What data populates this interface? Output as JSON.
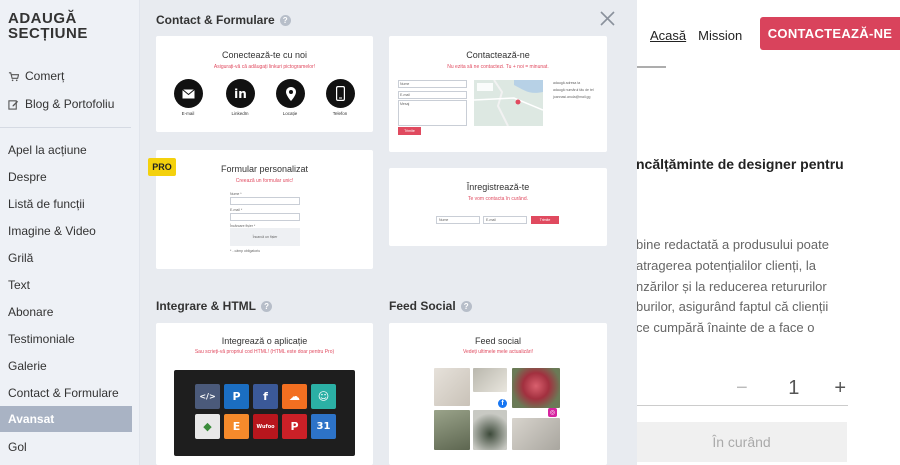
{
  "background": {
    "nav": {
      "home": "Acasă",
      "mission": "Mission",
      "cta": "CONTACTEAZĂ-NE"
    },
    "heading": "ncălțăminte de designer pentru",
    "paragraph": [
      "bine redactată a produsului poate",
      "atragerea potențialilor clienți, la",
      "nzărilor și la reducerea retururilor",
      "burilor, asigurând faptul că clienții",
      "ce cumpără înainte de a face o"
    ],
    "quantity": "1",
    "minus": "−",
    "plus": "+",
    "button": "În curând"
  },
  "sidebar": {
    "title_line1": "ADAUGĂ",
    "title_line2": "SECȚIUNE",
    "top_items": [
      {
        "label": "Comerț",
        "icon": "cart-icon"
      },
      {
        "label": "Blog & Portofoliu",
        "icon": "edit-icon"
      }
    ],
    "items": [
      "Apel la acțiune",
      "Despre",
      "Listă de funcții",
      "Imagine & Video",
      "Grilă",
      "Text",
      "Abonare",
      "Testimoniale",
      "Galerie",
      "Contact & Formulare",
      "Avansat",
      "Gol"
    ],
    "active": "Avansat"
  },
  "panel": {
    "section1": "Contact & Formulare",
    "section2": "Integrare & HTML",
    "section3": "Feed Social",
    "cards": {
      "connect": {
        "title": "Conectează-te cu noi",
        "subtitle": "Asigurați-vă că adăugați linkuri pictogramelor!",
        "items": [
          "E-mail",
          "LinkedIn",
          "Locație",
          "Telefon"
        ]
      },
      "contact": {
        "title": "Contactează-ne",
        "subtitle": "Nu ezita să ne contactezi. Tu + noi = minunat.",
        "fields": [
          "Nume",
          "E-mail",
          "Mesaj"
        ],
        "button": "Trimite",
        "info": [
          "adaugă adresa ta",
          "adaugă numărul tău de tel",
          "joannasi.anula@mail.gg"
        ]
      },
      "custom": {
        "title": "Formular personalizat",
        "subtitle": "Creează un formular unic!",
        "fields": [
          "Nume *",
          "E-mail *",
          "Încărcare fișier *"
        ],
        "upload": "Încarcă un fișier",
        "note": "* - câmp obligatoriu",
        "badge": "PRO"
      },
      "register": {
        "title": "Înregistrează-te",
        "subtitle": "Te vom contacta în curând.",
        "fields": [
          "Nume",
          "E-mail"
        ],
        "button": "Trimite"
      },
      "integrate": {
        "title": "Integrează o aplicație",
        "subtitle": "Sau scrieți-vă propriul cod HTML! (HTML este doar pentru Pro)"
      },
      "social": {
        "title": "Feed social",
        "subtitle": "Vedeți ultimele mele actualizări!"
      }
    }
  },
  "colors": {
    "accent": "#e04a5f",
    "cta": "#d9435c",
    "pro": "#f4d10d",
    "sidebar_active": "#a9b3c4"
  }
}
